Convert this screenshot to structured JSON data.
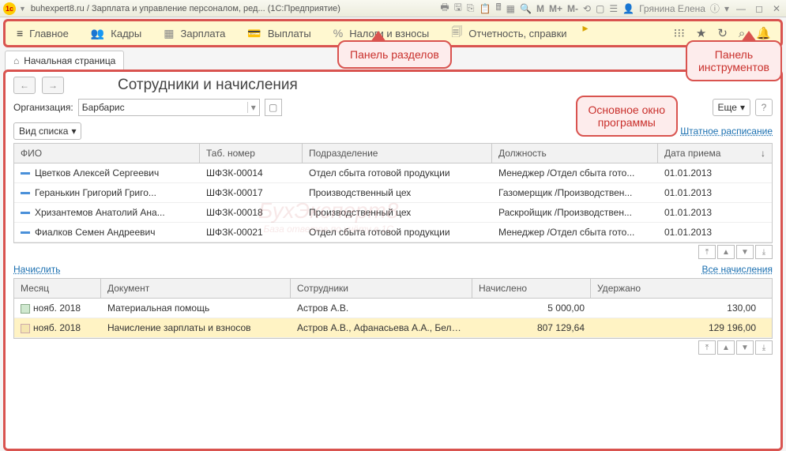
{
  "titlebar": {
    "text": "buhexpert8.ru / Зарплата и управление персоналом, ред... (1С:Предприятие)",
    "user": "Грянина Елена",
    "m_labels": [
      "M",
      "M+",
      "M-"
    ]
  },
  "sections": {
    "items": [
      {
        "icon": "≡",
        "label": "Главное"
      },
      {
        "icon": "👥",
        "label": "Кадры"
      },
      {
        "icon": "▦",
        "label": "Зарплата"
      },
      {
        "icon": "💳",
        "label": "Выплаты"
      },
      {
        "icon": "%",
        "label": "Налоги и взносы"
      },
      {
        "icon": "🗐",
        "label": "Отчетность, справки"
      }
    ]
  },
  "hometab": "Начальная страница",
  "nav": {
    "back": "←",
    "fwd": "→"
  },
  "heading": "Сотрудники и начисления",
  "org": {
    "label": "Организация:",
    "value": "Барбарис"
  },
  "more_btn": "Еще",
  "list_btn": "Вид списка",
  "link_staff": "Штатное расписание",
  "link_accrue": "Начислить",
  "link_all": "Все начисления",
  "columns_top": {
    "fio": "ФИО",
    "tab": "Таб. номер",
    "div": "Подразделение",
    "pos": "Должность",
    "date": "Дата приема"
  },
  "rows_top": [
    {
      "fio": "Цветков Алексей Сергеевич",
      "tab": "ШФЗК-00014",
      "div": "Отдел сбыта готовой продукции",
      "pos": "Менеджер /Отдел сбыта гото...",
      "date": "01.01.2013"
    },
    {
      "fio": "Геранькин Григорий Григо...",
      "tab": "ШФЗК-00017",
      "div": "Производственный цех",
      "pos": "Газомерщик /Производствен...",
      "date": "01.01.2013"
    },
    {
      "fio": "Хризантемов Анатолий Ана...",
      "tab": "ШФЗК-00018",
      "div": "Производственный цех",
      "pos": "Раскройщик /Производствен...",
      "date": "01.01.2013"
    },
    {
      "fio": "Фиалков Семен Андреевич",
      "tab": "ШФЗК-00021",
      "div": "Отдел сбыта готовой продукции",
      "pos": "Менеджер /Отдел сбыта гото...",
      "date": "01.01.2013"
    }
  ],
  "columns_bot": {
    "month": "Месяц",
    "doc": "Документ",
    "emp": "Сотрудники",
    "acc": "Начислено",
    "ded": "Удержано"
  },
  "rows_bot": [
    {
      "month": "нояб. 2018",
      "doc": "Материальная помощь",
      "emp": "Астров А.В.",
      "acc": "5 000,00",
      "ded": "130,00",
      "sel": false
    },
    {
      "month": "нояб. 2018",
      "doc": "Начисление зарплаты и взносов",
      "emp": "Астров А.В., Афанасьева А.А., Белобокин ...",
      "acc": "807 129,64",
      "ded": "129 196,00",
      "sel": true
    }
  ],
  "callouts": {
    "sections": "Панель разделов",
    "tools": "Панель\nинструментов",
    "main": "Основное окно\nпрограммы"
  },
  "watermark": {
    "main": "БухЭксперт8",
    "sub": "База ответов по учёту в 1С"
  }
}
